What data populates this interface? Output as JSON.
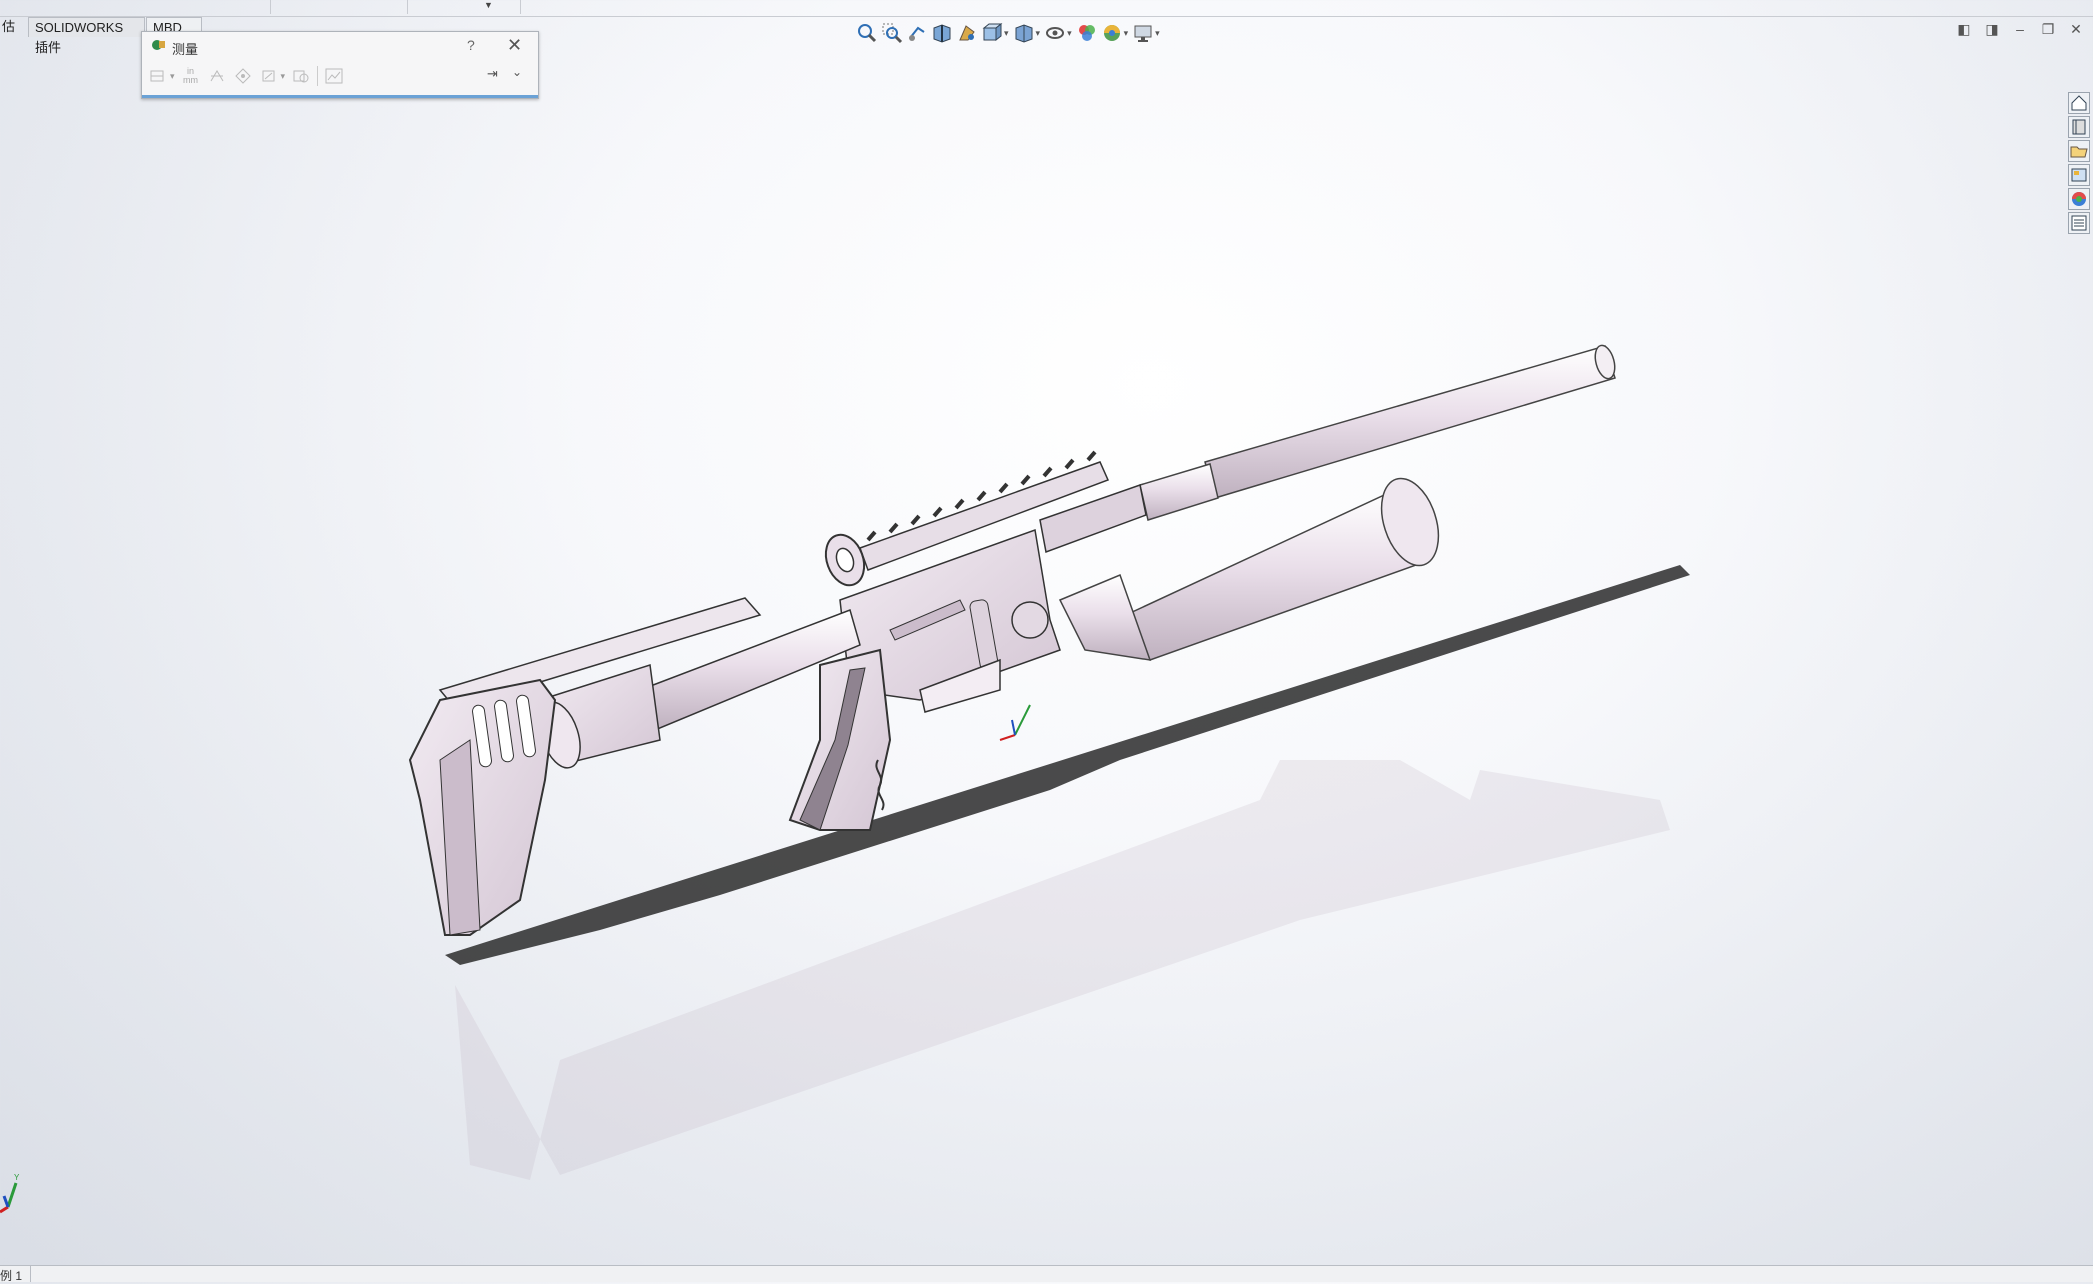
{
  "tabs": {
    "evaluate_fragment": "估",
    "addins": "SOLIDWORKS 插件",
    "mbd": "MBD"
  },
  "hud_icons": [
    "zoom-to-fit-icon",
    "zoom-to-area-icon",
    "previous-view-icon",
    "section-view-icon",
    "dynamic-annotation-icon",
    "view-orientation-icon",
    "display-style-icon",
    "hide-show-items-icon",
    "edit-appearance-icon",
    "apply-scene-icon",
    "view-settings-icon"
  ],
  "window_controls": [
    "tile-left-icon",
    "tile-right-icon",
    "minimize-icon",
    "restore-icon",
    "close-icon"
  ],
  "measure_dialog": {
    "title": "测量",
    "help": "?",
    "close": "✕",
    "units_label_top": "in",
    "units_label_bottom": "mm"
  },
  "task_pane": [
    "solidworks-resources-icon",
    "design-library-icon",
    "file-explorer-icon",
    "view-palette-icon",
    "appearances-icon",
    "custom-properties-icon"
  ],
  "triad": {
    "x": "X",
    "y": "Y",
    "z": "Z"
  },
  "status": {
    "text": "例 1"
  },
  "colors": {
    "model": "#e6dbe6",
    "model_edge": "#3a3a3a",
    "accent": "#6ba2d6"
  }
}
